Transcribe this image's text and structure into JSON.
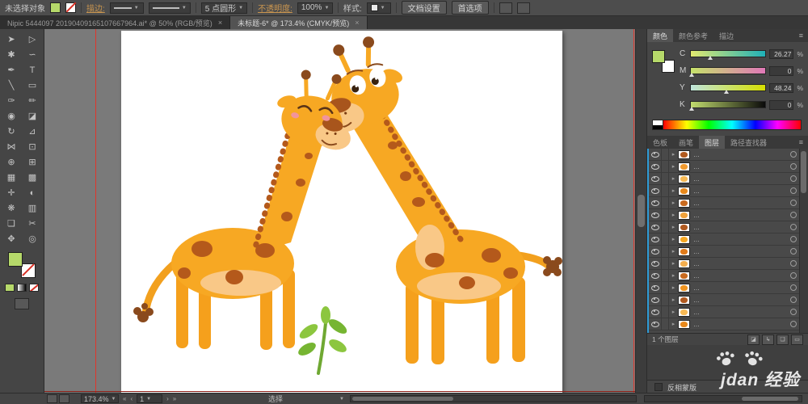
{
  "control_bar": {
    "no_selection": "未选择对象",
    "stroke_label": "描边:",
    "brush": "5 点圆形",
    "opacity_label": "不透明度:",
    "opacity_value": "100%",
    "style_label": "样式:",
    "doc_setup": "文档设置",
    "preferences": "首选项"
  },
  "tabs": {
    "doc1": {
      "label": "Nipic 5444097 20190409165107667964.ai* @ 50% (RGB/预览)",
      "close": "×"
    },
    "doc2": {
      "label": "未标题-6* @ 173.4% (CMYK/预览)",
      "close": "×"
    }
  },
  "toolbar": {
    "tools": [
      {
        "name": "selection",
        "glyph": "➤"
      },
      {
        "name": "direct-selection",
        "glyph": "▷"
      },
      {
        "name": "magic-wand",
        "glyph": "✱"
      },
      {
        "name": "lasso",
        "glyph": "∽"
      },
      {
        "name": "pen",
        "glyph": "✒"
      },
      {
        "name": "type",
        "glyph": "T"
      },
      {
        "name": "line-segment",
        "glyph": "╲"
      },
      {
        "name": "rectangle",
        "glyph": "▭"
      },
      {
        "name": "paintbrush",
        "glyph": "✑"
      },
      {
        "name": "pencil",
        "glyph": "✏"
      },
      {
        "name": "blob-brush",
        "glyph": "◉"
      },
      {
        "name": "eraser",
        "glyph": "◪"
      },
      {
        "name": "rotate",
        "glyph": "↻"
      },
      {
        "name": "scale",
        "glyph": "⊿"
      },
      {
        "name": "width",
        "glyph": "⋈"
      },
      {
        "name": "free-transform",
        "glyph": "⊡"
      },
      {
        "name": "shape-builder",
        "glyph": "⊕"
      },
      {
        "name": "perspective-grid",
        "glyph": "⊞"
      },
      {
        "name": "mesh",
        "glyph": "▦"
      },
      {
        "name": "gradient",
        "glyph": "▩"
      },
      {
        "name": "eyedropper",
        "glyph": "✛"
      },
      {
        "name": "blend",
        "glyph": "◐"
      },
      {
        "name": "symbol-sprayer",
        "glyph": "❋"
      },
      {
        "name": "column-graph",
        "glyph": "▥"
      },
      {
        "name": "artboard",
        "glyph": "❏"
      },
      {
        "name": "slice",
        "glyph": "✂"
      },
      {
        "name": "hand",
        "glyph": "✥"
      },
      {
        "name": "zoom",
        "glyph": "◎"
      }
    ]
  },
  "color_panel": {
    "tab_color": "颜色",
    "tab_guide": "颜色参考",
    "tab_stroke": "描边",
    "menu_icon": "≡",
    "percent": "%",
    "sliders": [
      {
        "label": "C",
        "value": "26.27"
      },
      {
        "label": "M",
        "value": "0"
      },
      {
        "label": "Y",
        "value": "48.24"
      },
      {
        "label": "K",
        "value": "0"
      }
    ]
  },
  "panel_tabs": {
    "swatches": "色板",
    "brushes": "画笔",
    "layers": "图层",
    "pathfinder": "路径查找器",
    "menu_icon": "≡"
  },
  "layers": {
    "footer_count": "1 个图层",
    "rows": [
      {
        "name": "…",
        "thumb": "#b15a1f"
      },
      {
        "name": "…",
        "thumb": "#f29a2e"
      },
      {
        "name": "…",
        "thumb": "#f7b954"
      },
      {
        "name": "…",
        "thumb": "#e8891c"
      },
      {
        "name": "…",
        "thumb": "#c96a1e"
      },
      {
        "name": "…",
        "thumb": "#f0a23c"
      },
      {
        "name": "…",
        "thumb": "#b15a1f"
      },
      {
        "name": "…",
        "thumb": "#f7a823"
      },
      {
        "name": "…",
        "thumb": "#e07b1a"
      },
      {
        "name": "…",
        "thumb": "#f3ae4e"
      },
      {
        "name": "…",
        "thumb": "#c96a1e"
      },
      {
        "name": "…",
        "thumb": "#f0941f"
      },
      {
        "name": "…",
        "thumb": "#b15a1f"
      },
      {
        "name": "…",
        "thumb": "#f7b954"
      },
      {
        "name": "…",
        "thumb": "#e8891c"
      }
    ]
  },
  "mask_panel": {
    "label": "反相蒙版"
  },
  "status_bar": {
    "zoom": "173.4%",
    "page": "1",
    "tool": "选择"
  },
  "watermark": {
    "text": "jdan 经验"
  }
}
